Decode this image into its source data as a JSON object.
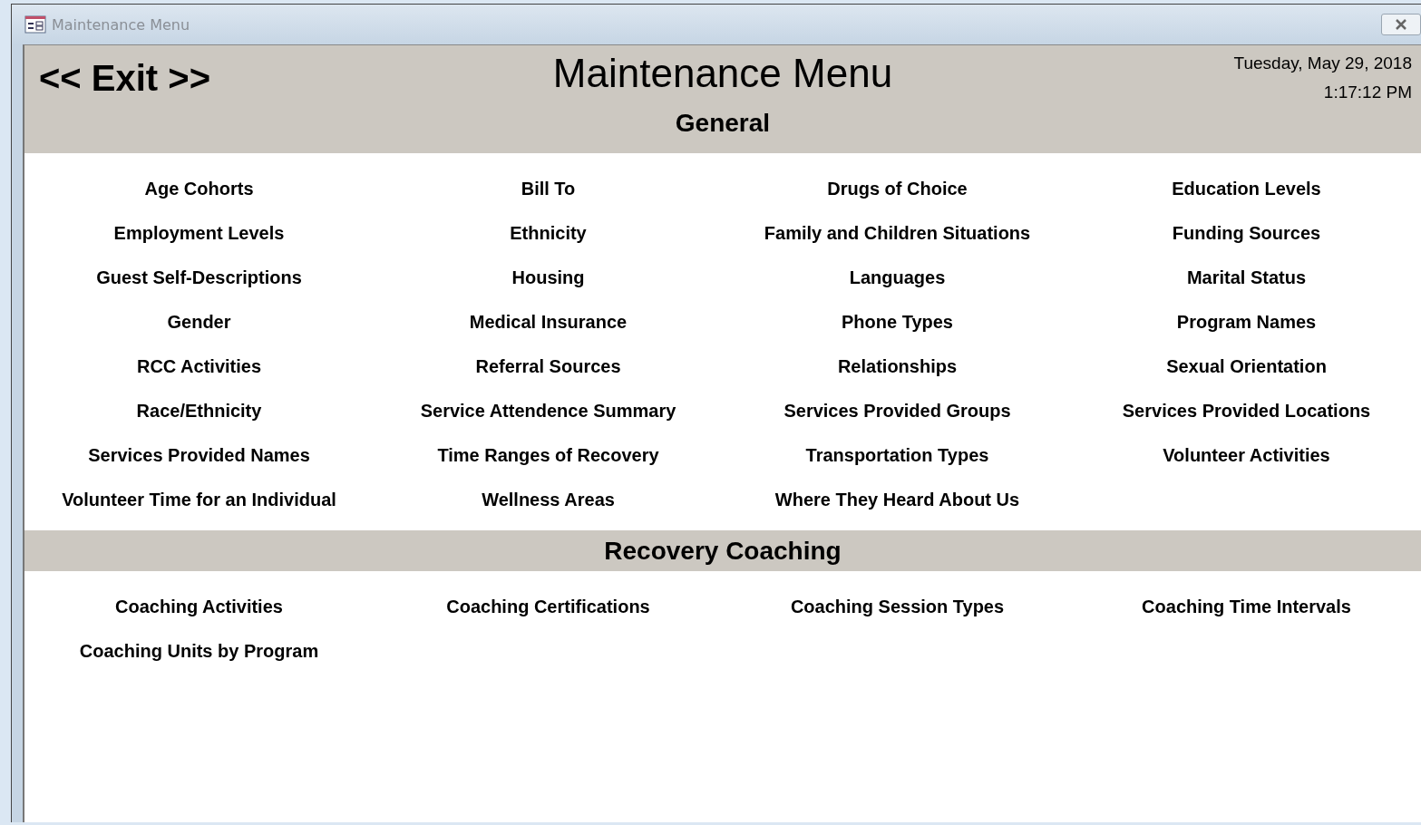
{
  "window": {
    "title": "Maintenance Menu"
  },
  "header": {
    "exit_button": "<< Exit >>",
    "title": "Maintenance Menu",
    "date": "Tuesday, May 29, 2018",
    "time": "1:17:12 PM"
  },
  "sections": [
    {
      "title": "General",
      "items": [
        "Age Cohorts",
        "Bill To",
        "Drugs of Choice",
        "Education Levels",
        "Employment Levels",
        "Ethnicity",
        "Family and Children Situations",
        "Funding Sources",
        "Guest Self-Descriptions",
        "Housing",
        "Languages",
        "Marital Status",
        "Gender",
        "Medical Insurance",
        "Phone Types",
        "Program Names",
        "RCC Activities",
        "Referral Sources",
        "Relationships",
        "Sexual Orientation",
        "Race/Ethnicity",
        "Service Attendence Summary",
        "Services Provided Groups",
        "Services Provided Locations",
        "Services Provided Names",
        "Time Ranges of Recovery",
        "Transportation Types",
        "Volunteer Activities",
        "Volunteer Time for an Individual",
        "Wellness Areas",
        "Where They Heard About Us"
      ]
    },
    {
      "title": "Recovery Coaching",
      "items": [
        "Coaching Activities",
        "Coaching Certifications",
        "Coaching Session Types",
        "Coaching Time Intervals",
        "Coaching Units by Program"
      ]
    }
  ]
}
